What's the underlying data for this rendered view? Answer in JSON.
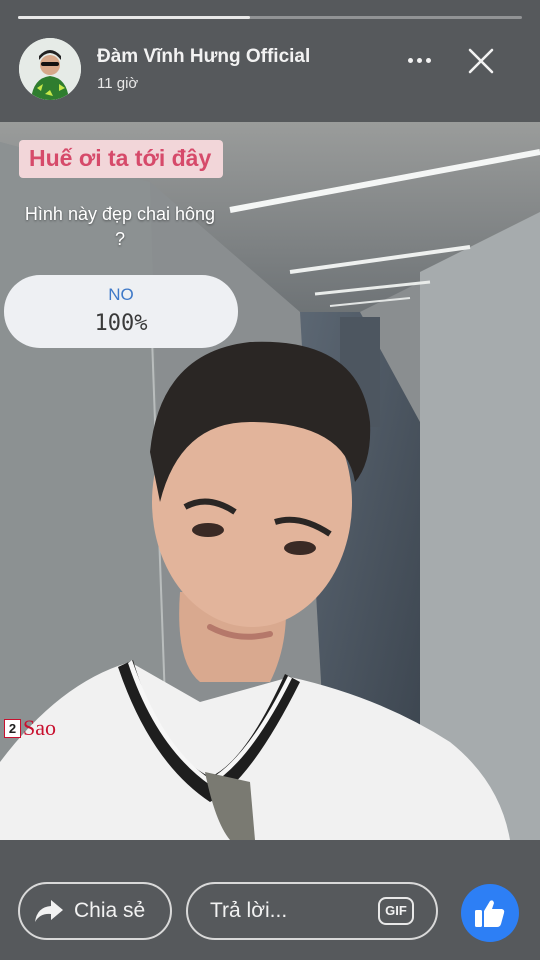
{
  "header": {
    "author": "Đàm Vĩnh Hưng Official",
    "time": "11 giờ",
    "story_progress": 0.46
  },
  "story": {
    "sticker_title": "Huế ơi ta tới đây",
    "question": "Hình này đẹp chai hông ?",
    "poll": {
      "option": "NO",
      "percent": "100%"
    },
    "watermark": {
      "number": "2",
      "text": "Sao"
    }
  },
  "footer": {
    "share_label": "Chia sẻ",
    "reply_placeholder": "Trả lời...",
    "gif_label": "GIF"
  },
  "colors": {
    "like_blue": "#2d7ff5",
    "poll_option": "#3f79c8",
    "sticker_text": "#d64a6a"
  },
  "icons": {
    "more": "more-icon",
    "close": "close-icon",
    "share": "share-arrow-icon",
    "like": "thumbs-up-icon"
  }
}
